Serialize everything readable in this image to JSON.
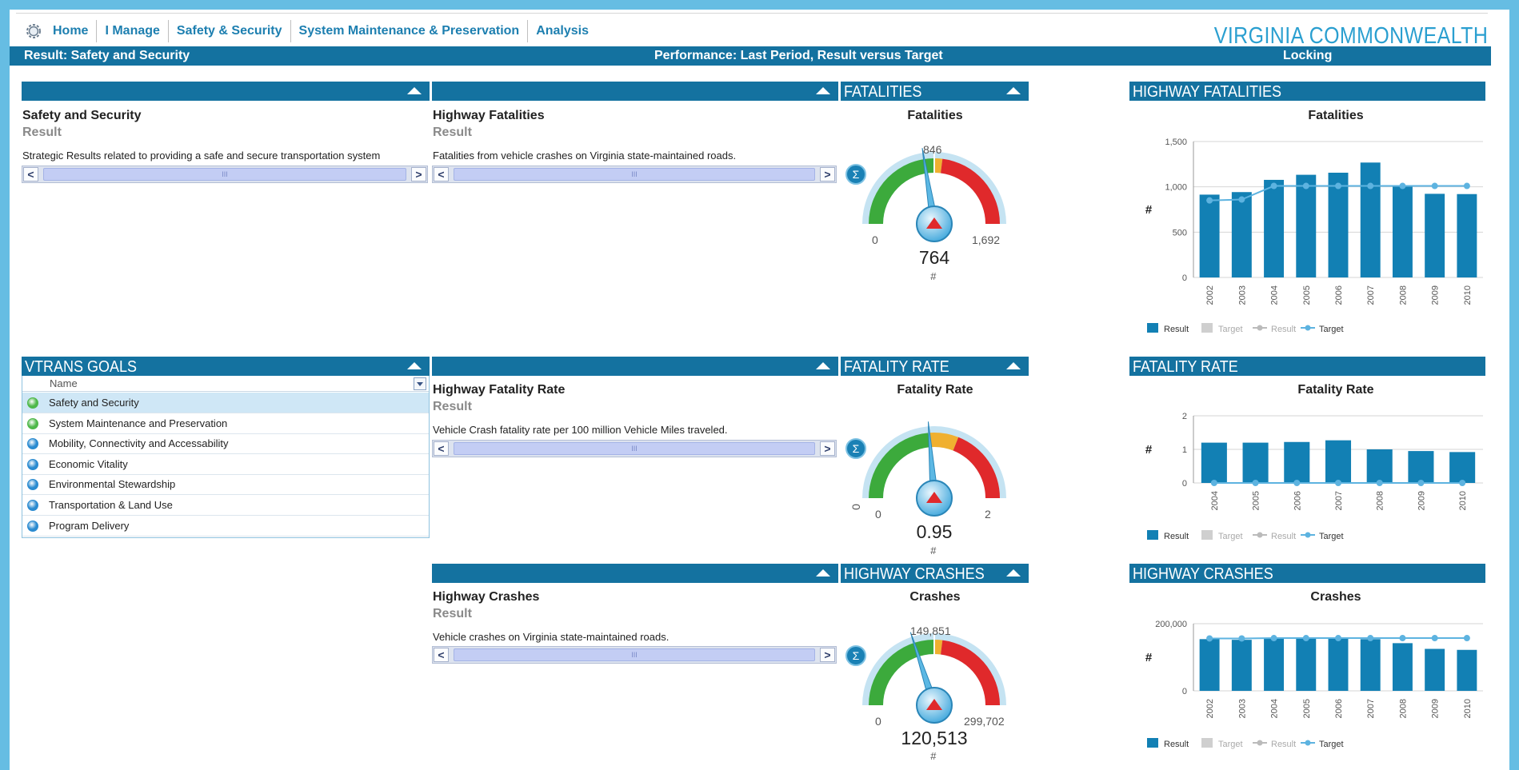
{
  "nav": {
    "items": [
      "Home",
      "I Manage",
      "Safety & Security",
      "System Maintenance & Preservation",
      "Analysis"
    ],
    "brand": "VIRGINIA COMMONWEALTH"
  },
  "infobar": {
    "left": "Result: Safety and Security",
    "center": "Performance: Last Period, Result versus Target",
    "right": "Locking"
  },
  "colors": {
    "accent": "#1472a0",
    "bar": "#1280b4",
    "target_line": "#5db3e0"
  },
  "results": [
    {
      "title": "Safety and Security",
      "subtitle": "Result",
      "description": "Strategic Results related to providing a safe and secure transportation system"
    },
    {
      "title": "Highway Fatalities",
      "subtitle": "Result",
      "description": "Fatalities from vehicle crashes on Virginia state-maintained roads."
    },
    {
      "title": "Highway Fatality Rate",
      "subtitle": "Result",
      "description": "Vehicle Crash fatality rate per 100 million Vehicle Miles traveled."
    },
    {
      "title": "Highway Crashes",
      "subtitle": "Result",
      "description": "Vehicle crashes on Virginia state-maintained roads."
    }
  ],
  "scroll_grip": "III",
  "goals": {
    "header": "VTRANS GOALS",
    "column": "Name",
    "items": [
      {
        "name": "Safety and Security",
        "status": "green"
      },
      {
        "name": "System Maintenance and Preservation",
        "status": "green"
      },
      {
        "name": "Mobility, Connectivity and Accessability",
        "status": "blue"
      },
      {
        "name": "Economic Vitality",
        "status": "blue"
      },
      {
        "name": "Environmental Stewardship",
        "status": "blue"
      },
      {
        "name": "Transportation & Land Use",
        "status": "blue"
      },
      {
        "name": "Program Delivery",
        "status": "blue"
      }
    ]
  },
  "gauges": [
    {
      "header": "FATALITIES",
      "title": "Fatalities",
      "min": "0",
      "max": "1,692",
      "target": "846",
      "value": "764",
      "unit": "#",
      "value_fraction": 0.45,
      "target_fraction": 0.5
    },
    {
      "header": "FATALITY RATE",
      "title": "Fatality Rate",
      "min": "0",
      "max": "2",
      "target": "0",
      "value": "0.95",
      "unit": "#",
      "value_fraction": 0.475,
      "target_fraction": 0.0
    },
    {
      "header": "HIGHWAY CRASHES",
      "title": "Crashes",
      "min": "0",
      "max": "299,702",
      "target": "149,851",
      "value": "120,513",
      "unit": "#",
      "value_fraction": 0.4,
      "target_fraction": 0.5
    }
  ],
  "sigma_symbol": "Σ",
  "chart_data": [
    {
      "type": "bar",
      "header": "HIGHWAY FATALITIES",
      "title": "Fatalities",
      "ylabel": "#",
      "categories": [
        "2002",
        "2003",
        "2004",
        "2005",
        "2006",
        "2007",
        "2008",
        "2009",
        "2010"
      ],
      "yticks": [
        "0",
        "500",
        "1,000",
        "1,500"
      ],
      "ylim": [
        0,
        1500
      ],
      "series": [
        {
          "name": "Result",
          "values": [
            914,
            942,
            1077,
            1133,
            1156,
            1268,
            1001,
            923,
            920
          ]
        },
        {
          "name": "Target",
          "values": [
            850,
            860,
            1010,
            1010,
            1010,
            1010,
            1010,
            1010,
            1010
          ]
        }
      ],
      "legend": [
        "Result",
        "Target",
        "Result",
        "Target"
      ],
      "grid": true
    },
    {
      "type": "bar",
      "header": "FATALITY RATE",
      "title": "Fatality Rate",
      "ylabel": "#",
      "categories": [
        "2004",
        "2005",
        "2006",
        "2007",
        "2008",
        "2009",
        "2010"
      ],
      "yticks": [
        "0",
        "1",
        "2"
      ],
      "ylim": [
        0,
        2
      ],
      "series": [
        {
          "name": "Result",
          "values": [
            1.2,
            1.2,
            1.22,
            1.27,
            1.0,
            0.95,
            0.92
          ]
        },
        {
          "name": "Target",
          "values": [
            0,
            0,
            0,
            0,
            0,
            0,
            0
          ]
        }
      ],
      "legend": [
        "Result",
        "Target",
        "Result",
        "Target"
      ],
      "grid": true
    },
    {
      "type": "bar",
      "header": "HIGHWAY CRASHES",
      "title": "Crashes",
      "ylabel": "#",
      "categories": [
        "2002",
        "2003",
        "2004",
        "2005",
        "2006",
        "2007",
        "2008",
        "2009",
        "2010"
      ],
      "yticks": [
        "0",
        "200,000"
      ],
      "ylim": [
        0,
        200000
      ],
      "series": [
        {
          "name": "Result",
          "values": [
            154000,
            152000,
            156000,
            157000,
            156000,
            154000,
            142000,
            125000,
            122000
          ]
        },
        {
          "name": "Target",
          "values": [
            156000,
            156000,
            157000,
            157000,
            157000,
            157000,
            157000,
            157000,
            157000
          ]
        }
      ],
      "legend": [
        "Result",
        "Target",
        "Result",
        "Target"
      ],
      "grid": true
    }
  ]
}
